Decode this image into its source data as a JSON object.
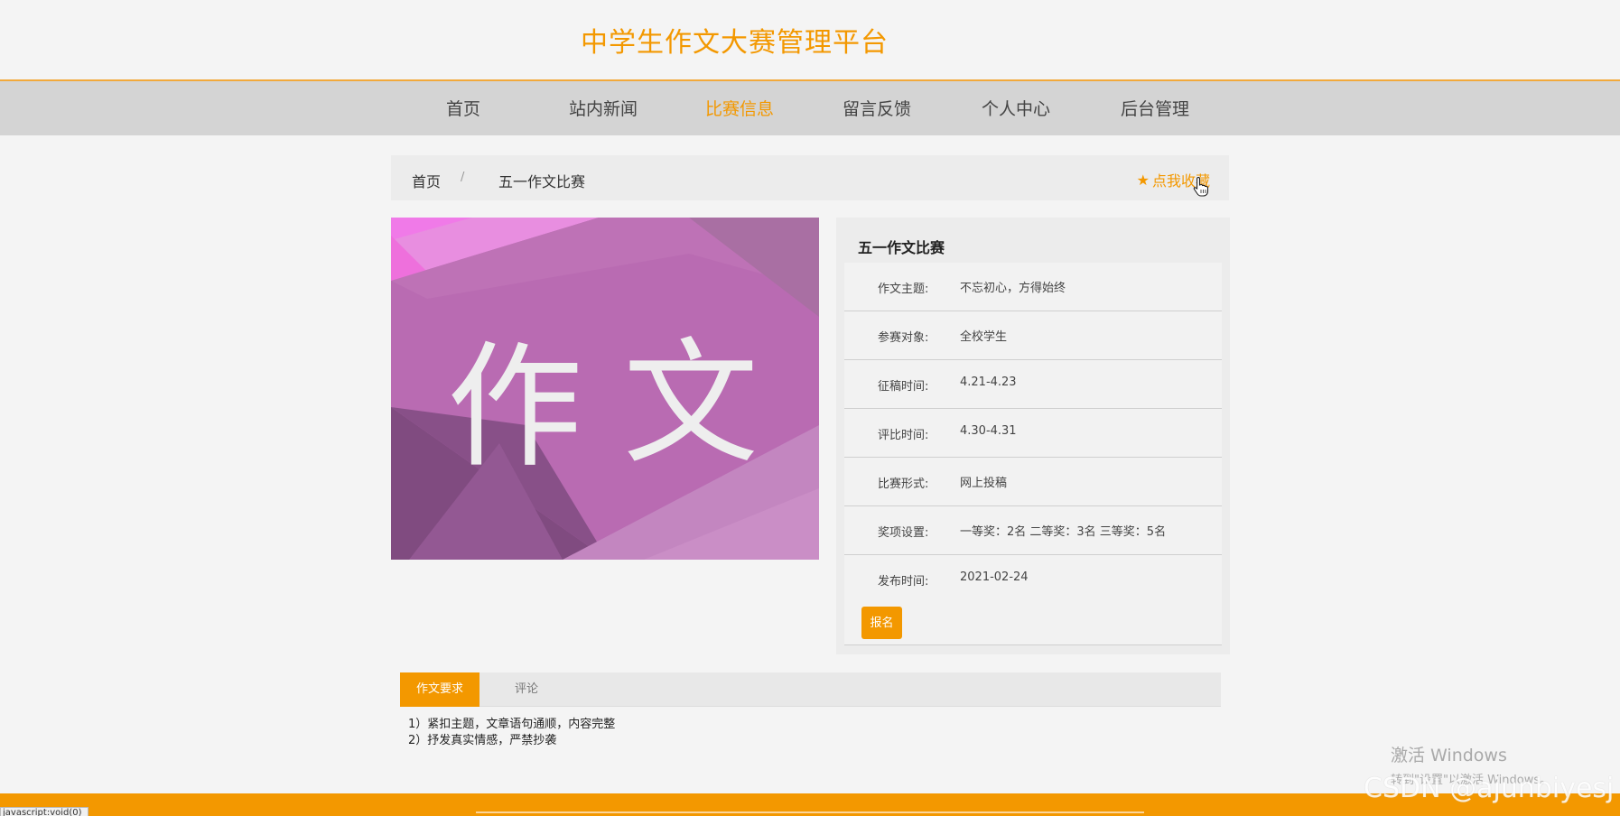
{
  "header": {
    "title": "中学生作文大赛管理平台"
  },
  "nav": {
    "items": [
      {
        "label": "首页"
      },
      {
        "label": "站内新闻"
      },
      {
        "label": "比赛信息"
      },
      {
        "label": "留言反馈"
      },
      {
        "label": "个人中心"
      },
      {
        "label": "后台管理"
      }
    ],
    "active_index": 2
  },
  "breadcrumb": {
    "home": "首页",
    "separator": "/",
    "current": "五一作文比赛",
    "collect_label": "点我收藏",
    "collect_icon": "star-icon"
  },
  "cover": {
    "text_left": "作",
    "text_right": "文"
  },
  "detail": {
    "title": "五一作文比赛",
    "rows": [
      {
        "label": "作文主题:",
        "value": "不忘初心，方得始终"
      },
      {
        "label": "参赛对象:",
        "value": "全校学生"
      },
      {
        "label": "征稿时间:",
        "value": "4.21-4.23"
      },
      {
        "label": "评比时间:",
        "value": "4.30-4.31"
      },
      {
        "label": "比赛形式:",
        "value": "网上投稿"
      },
      {
        "label": "奖项设置:",
        "value": "一等奖：2名 二等奖：3名 三等奖：5名"
      },
      {
        "label": "发布时间:",
        "value": "2021-02-24"
      }
    ],
    "signup_label": "报名"
  },
  "tabs": {
    "active": "作文要求",
    "other": "评论"
  },
  "requirements": {
    "line1": "1）紧扣主题，文章语句通顺，内容完整",
    "line2": "2）抒发真实情感，严禁抄袭"
  },
  "statusbar": {
    "url": "javascript:void(0)"
  },
  "os_overlay": {
    "activate_title": "激活 Windows",
    "activate_hint": "转到\"设置\"以激活 Windows。",
    "watermark": "CSDN @ajunbiyesj"
  },
  "colors": {
    "accent": "#f39800",
    "nav_bg": "#d4d4d4",
    "page_bg": "#f4f4f4"
  }
}
